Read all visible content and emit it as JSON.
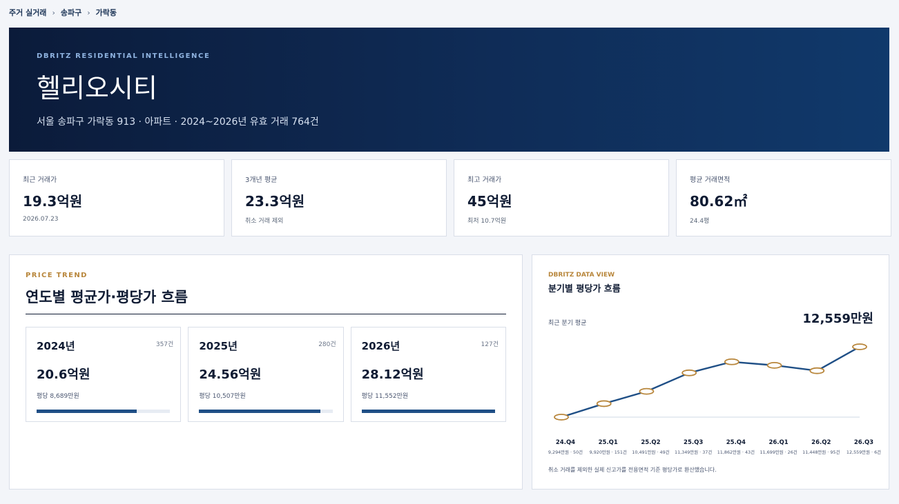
{
  "breadcrumb": [
    "주거 실거래",
    "송파구",
    "가락동"
  ],
  "hero": {
    "eyebrow": "DBRITZ RESIDENTIAL INTELLIGENCE",
    "title": "헬리오시티",
    "subtitle": "서울 송파구 가락동 913 · 아파트 · 2024~2026년 유효 거래 764건"
  },
  "stats": [
    {
      "label": "최근 거래가",
      "value": "19.3억원",
      "note": "2026.07.23"
    },
    {
      "label": "3개년 평균",
      "value": "23.3억원",
      "note": "취소 거래 제외"
    },
    {
      "label": "최고 거래가",
      "value": "45억원",
      "note": "최저 10.7억원"
    },
    {
      "label": "평균 거래면적",
      "value": "80.62㎡",
      "note": "24.4평"
    }
  ],
  "trend": {
    "eyebrow": "PRICE TREND",
    "title": "연도별 평균가·평당가 흐름",
    "years": [
      {
        "year": "2024년",
        "count": "357건",
        "avg": "20.6억원",
        "per_pyeong": "평당 8,689만원",
        "fill": 0.75
      },
      {
        "year": "2025년",
        "count": "280건",
        "avg": "24.56억원",
        "per_pyeong": "평당 10,507만원",
        "fill": 0.91
      },
      {
        "year": "2026년",
        "count": "127건",
        "avg": "28.12억원",
        "per_pyeong": "평당 11,552만원",
        "fill": 1.0
      }
    ]
  },
  "view": {
    "eyebrow": "DBRITZ DATA VIEW",
    "title": "분기별 평당가 흐름",
    "latest_label": "최근 분기 평균",
    "latest_value": "12,559만원",
    "footnote": "취소 거래를 제외한 실제 신고가를 전용면적 기준 평당가로 환산했습니다.",
    "sublabels": [
      "9,294만원 · 50건",
      "9,920만원 · 151건",
      "10,491만원 · 49건",
      "11,349만원 · 37건",
      "11,862만원 · 43건",
      "11,699만원 · 26건",
      "11,448만원 · 95건",
      "12,559만원 · 6건"
    ]
  },
  "chart_data": {
    "type": "line",
    "categories": [
      "24.Q4",
      "25.Q1",
      "25.Q2",
      "25.Q3",
      "25.Q4",
      "26.Q1",
      "26.Q2",
      "26.Q3"
    ],
    "series": [
      {
        "values": [
          9294,
          9920,
          10491,
          11349,
          11862,
          11699,
          11448,
          12559
        ]
      }
    ],
    "ylim": [
      9294,
      12559
    ],
    "grid": false,
    "colors": {
      "line": "#1f4f86",
      "marker_fill": "#ffffff",
      "marker_stroke": "#b8863b",
      "baseline": "#dfe5ee"
    }
  },
  "colors": {
    "accent_gold": "#b8863b",
    "navy": "#0b1b3a",
    "bar": "#1f4f86"
  }
}
